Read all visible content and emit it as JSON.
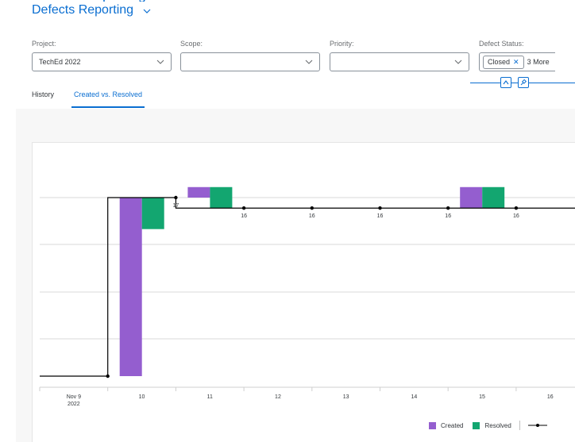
{
  "header": {
    "title": "Defects Reporting"
  },
  "filters": {
    "project": {
      "label": "Project:",
      "value": "TechEd 2022"
    },
    "scope": {
      "label": "Scope:",
      "value": ""
    },
    "priority": {
      "label": "Priority:",
      "value": ""
    },
    "defect_status": {
      "label": "Defect Status:",
      "token": "Closed",
      "more": "3 More"
    }
  },
  "tabs": [
    {
      "label": "History",
      "active": false
    },
    {
      "label": "Created vs. Resolved",
      "active": true
    }
  ],
  "legend": {
    "created": "Created",
    "resolved": "Resolved"
  },
  "colors": {
    "accent": "#0a6ed1",
    "created": "#945ecf",
    "resolved": "#13a670"
  },
  "chart_data": {
    "type": "bar",
    "categories": [
      "Nov 9\n2022",
      "10",
      "11",
      "12",
      "13",
      "14",
      "15",
      "16"
    ],
    "series": [
      {
        "name": "Created",
        "values": [
          0,
          17,
          1,
          0,
          0,
          0,
          2,
          0
        ]
      },
      {
        "name": "Resolved",
        "values": [
          0,
          3,
          2,
          0,
          0,
          0,
          2,
          0
        ]
      }
    ],
    "line_values": [
      0,
      17,
      16,
      16,
      16,
      16,
      16,
      16
    ],
    "line_labels": [
      "",
      "17",
      "16",
      "16",
      "16",
      "16",
      "16",
      "16"
    ],
    "ylim": [
      0,
      20
    ],
    "grid": true,
    "legend": "bottom-right"
  }
}
